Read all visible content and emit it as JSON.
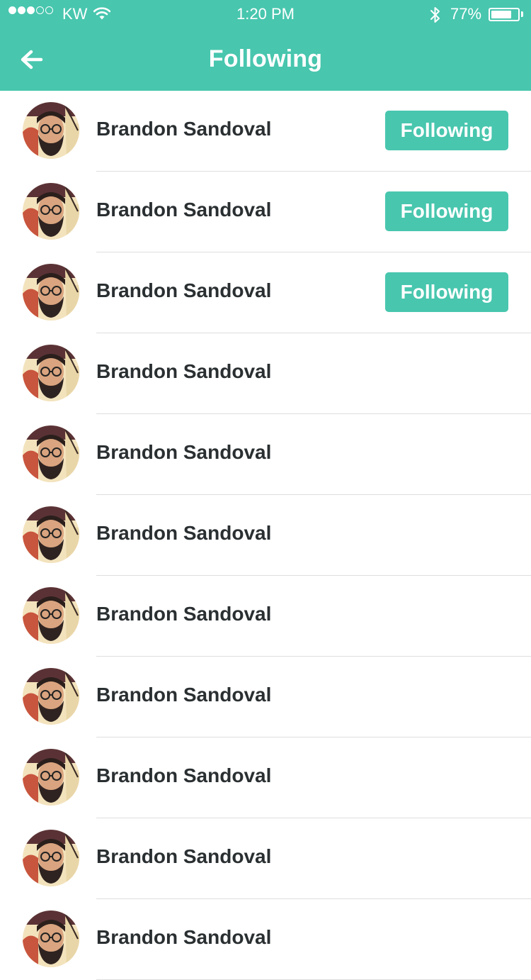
{
  "status_bar": {
    "carrier": "KW",
    "signal_bars_filled": 3,
    "signal_bars_total": 5,
    "time": "1:20 PM",
    "battery_percent": "77%",
    "battery_level": 0.77,
    "icons": [
      "wifi-icon",
      "bluetooth-icon",
      "battery-icon"
    ]
  },
  "header": {
    "title": "Following",
    "back_icon": "back-arrow-icon"
  },
  "colors": {
    "accent": "#48c6ae",
    "text": "#2a2f31",
    "divider": "#dedede"
  },
  "users": [
    {
      "name": "Brandon Sandoval",
      "button": "Following"
    },
    {
      "name": "Brandon Sandoval",
      "button": "Following"
    },
    {
      "name": "Brandon Sandoval",
      "button": "Following"
    },
    {
      "name": "Brandon Sandoval",
      "button": ""
    },
    {
      "name": "Brandon Sandoval",
      "button": ""
    },
    {
      "name": "Brandon Sandoval",
      "button": ""
    },
    {
      "name": "Brandon Sandoval",
      "button": ""
    },
    {
      "name": "Brandon Sandoval",
      "button": ""
    },
    {
      "name": "Brandon Sandoval",
      "button": ""
    },
    {
      "name": "Brandon Sandoval",
      "button": ""
    },
    {
      "name": "Brandon Sandoval",
      "button": ""
    }
  ]
}
